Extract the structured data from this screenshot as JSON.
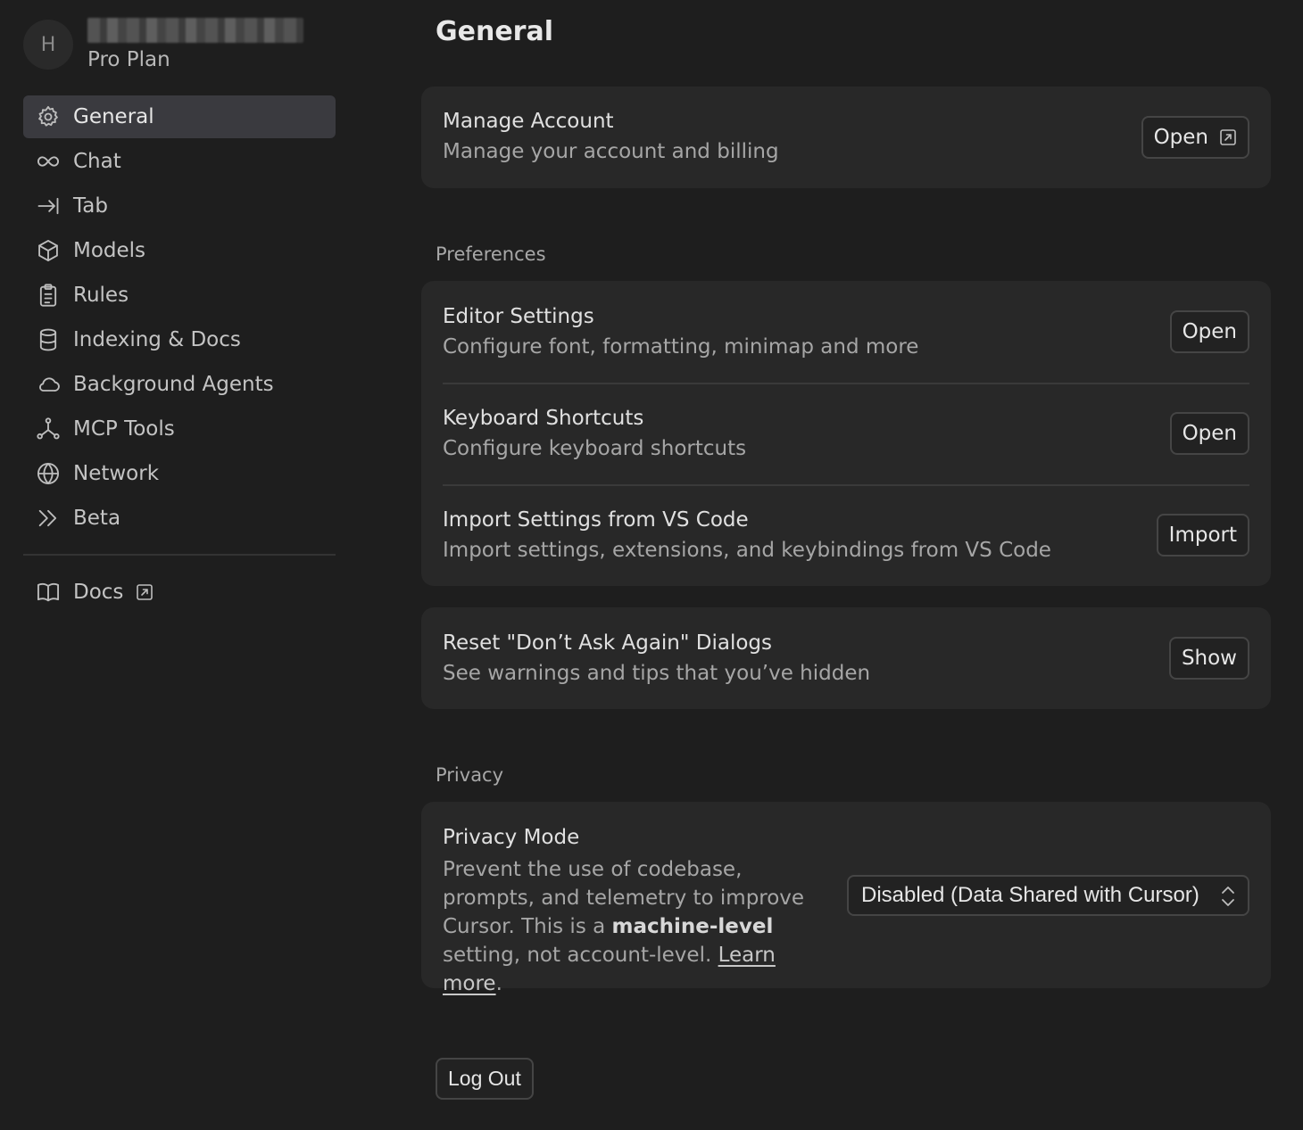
{
  "user": {
    "avatar_initial": "H",
    "name_blurred": "",
    "plan": "Pro Plan"
  },
  "sidebar": {
    "items": [
      {
        "label": "General",
        "icon": "gear-icon",
        "active": true
      },
      {
        "label": "Chat",
        "icon": "infinity-icon"
      },
      {
        "label": "Tab",
        "icon": "tab-arrow-icon"
      },
      {
        "label": "Models",
        "icon": "cube-icon"
      },
      {
        "label": "Rules",
        "icon": "clipboard-icon"
      },
      {
        "label": "Indexing & Docs",
        "icon": "database-icon"
      },
      {
        "label": "Background Agents",
        "icon": "cloud-icon"
      },
      {
        "label": "MCP Tools",
        "icon": "nodes-icon"
      },
      {
        "label": "Network",
        "icon": "globe-icon"
      },
      {
        "label": "Beta",
        "icon": "double-chevron-icon"
      }
    ],
    "docs_label": "Docs"
  },
  "main": {
    "title": "General",
    "account": {
      "title": "Manage Account",
      "desc": "Manage your account and billing",
      "button": "Open"
    },
    "preferences_label": "Preferences",
    "preferences": [
      {
        "title": "Editor Settings",
        "desc": "Configure font, formatting, minimap and more",
        "button": "Open"
      },
      {
        "title": "Keyboard Shortcuts",
        "desc": "Configure keyboard shortcuts",
        "button": "Open"
      },
      {
        "title": "Import Settings from VS Code",
        "desc": "Import settings, extensions, and keybindings from VS Code",
        "button": "Import"
      }
    ],
    "reset": {
      "title": "Reset \"Don’t Ask Again\" Dialogs",
      "desc": "See warnings and tips that you’ve hidden",
      "button": "Show"
    },
    "privacy_label": "Privacy",
    "privacy": {
      "title": "Privacy Mode",
      "desc_part1": "Prevent the use of codebase, prompts, and telemetry to improve Cursor. This is a ",
      "desc_bold": "machine-level",
      "desc_part2": " setting, not account-level. ",
      "learn_more": "Learn more",
      "desc_end": ".",
      "select_value": "Disabled (Data Shared with Cursor)"
    },
    "logout_label": "Log Out"
  }
}
